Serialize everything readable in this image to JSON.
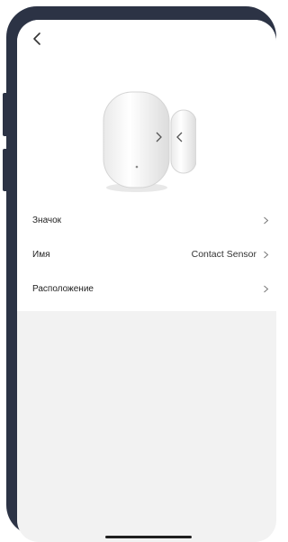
{
  "nav": {
    "back_icon": "chevron-left-icon"
  },
  "device": {
    "image": "contact-sensor-device"
  },
  "settings": {
    "items": [
      {
        "label": "Значок",
        "value": ""
      },
      {
        "label": "Имя",
        "value": "Contact Sensor"
      },
      {
        "label": "Расположение",
        "value": ""
      }
    ]
  }
}
